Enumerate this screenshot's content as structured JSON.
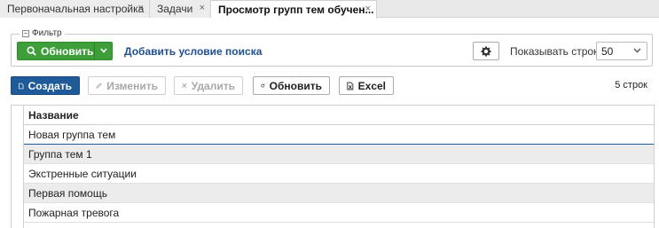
{
  "tabs": [
    {
      "label": "Первоначальная настройка",
      "close": "×"
    },
    {
      "label": "Задачи",
      "close": "×"
    },
    {
      "label": "Просмотр групп тем обучен...",
      "close": "×"
    }
  ],
  "filter": {
    "legend": "Фильтр",
    "collapse_glyph": "−",
    "refresh_label": "Обновить",
    "add_condition_label": "Добавить условие поиска",
    "rows_label": "Показывать строк",
    "rows_value": "50"
  },
  "toolbar": {
    "create_label": "Создать",
    "edit_label": "Изменить",
    "delete_label": "Удалить",
    "refresh_label": "Обновить",
    "excel_label": "Excel",
    "count_label": "5 строк"
  },
  "table": {
    "column_header": "Название",
    "rows": [
      "Новая группа тем",
      "Группа тем 1",
      "Экстренные ситуации",
      "Первая помощь",
      "Пожарная тревога"
    ]
  },
  "icons": {
    "search": "search-icon",
    "chevron": "chevron-down-icon",
    "gear": "gear-icon",
    "document": "document-icon",
    "pencil": "pencil-icon",
    "delete": "close-icon",
    "refresh": "refresh-icon",
    "excel": "excel-icon"
  },
  "colors": {
    "accent_green": "#3e9f3a",
    "primary_blue": "#1f5b99",
    "link_blue": "#1e4f8f"
  }
}
